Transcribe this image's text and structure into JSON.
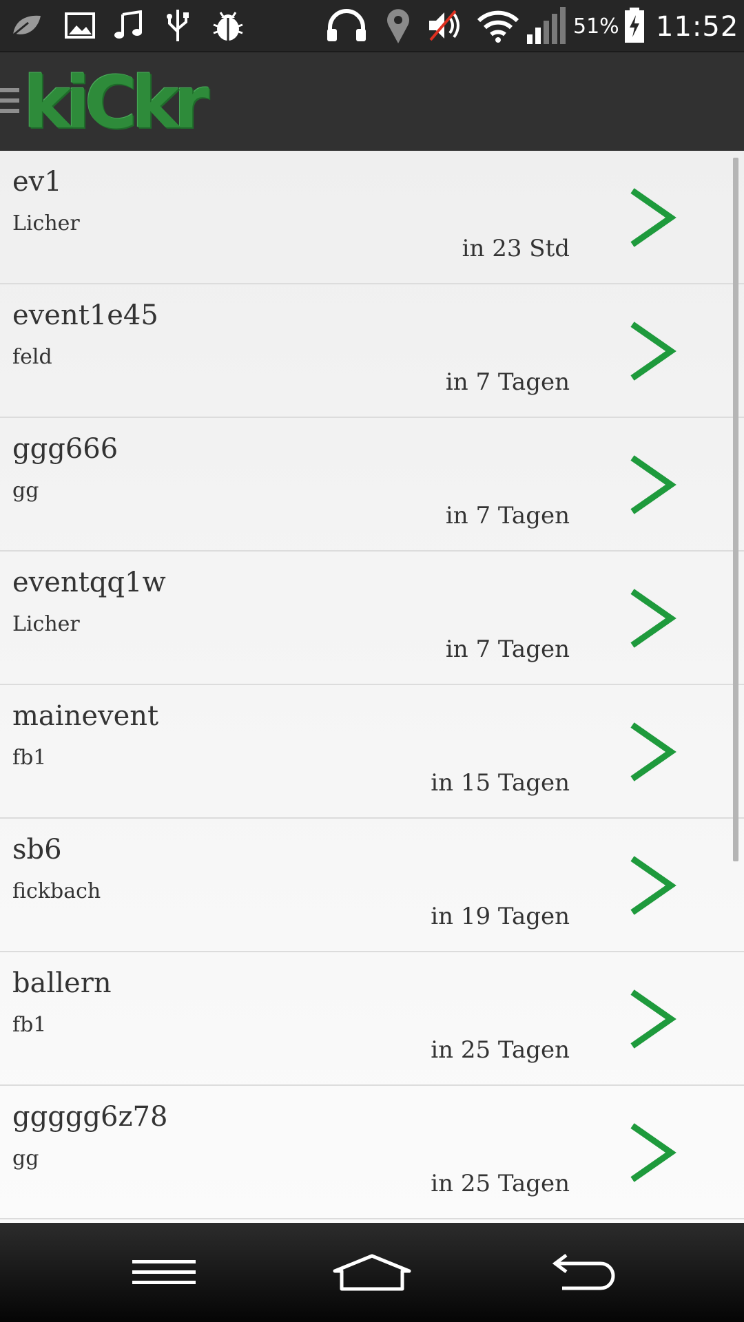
{
  "status_bar": {
    "icons": [
      "leaf-icon",
      "image-icon",
      "music-icon",
      "usb-icon",
      "bug-icon",
      "headphones-icon",
      "location-icon",
      "muted-volume-icon",
      "wifi-icon",
      "signal-icon",
      "battery-charging-icon"
    ],
    "battery_percent": "51%",
    "time": "11:52"
  },
  "action_bar": {
    "logo_text": "kiCkr",
    "brand_color": "#2e8b3a"
  },
  "events": [
    {
      "title": "ev1",
      "location": "Licher",
      "time": "in 23 Std"
    },
    {
      "title": "event1e45",
      "location": "feld",
      "time": "in 7 Tagen"
    },
    {
      "title": "ggg666",
      "location": "gg",
      "time": "in 7 Tagen"
    },
    {
      "title": "eventqq1w",
      "location": "Licher",
      "time": "in 7 Tagen"
    },
    {
      "title": "mainevent",
      "location": "fb1",
      "time": "in 15 Tagen"
    },
    {
      "title": "sb6",
      "location": "fickbach",
      "time": "in 19 Tagen"
    },
    {
      "title": "ballern",
      "location": "fb1",
      "time": "in 25 Tagen"
    },
    {
      "title": "ggggg6z78",
      "location": "gg",
      "time": "in 25 Tagen"
    }
  ],
  "accent_color": "#1e9a3c",
  "nav_bar": {
    "icons": [
      "menu-icon",
      "home-icon",
      "back-icon"
    ]
  }
}
